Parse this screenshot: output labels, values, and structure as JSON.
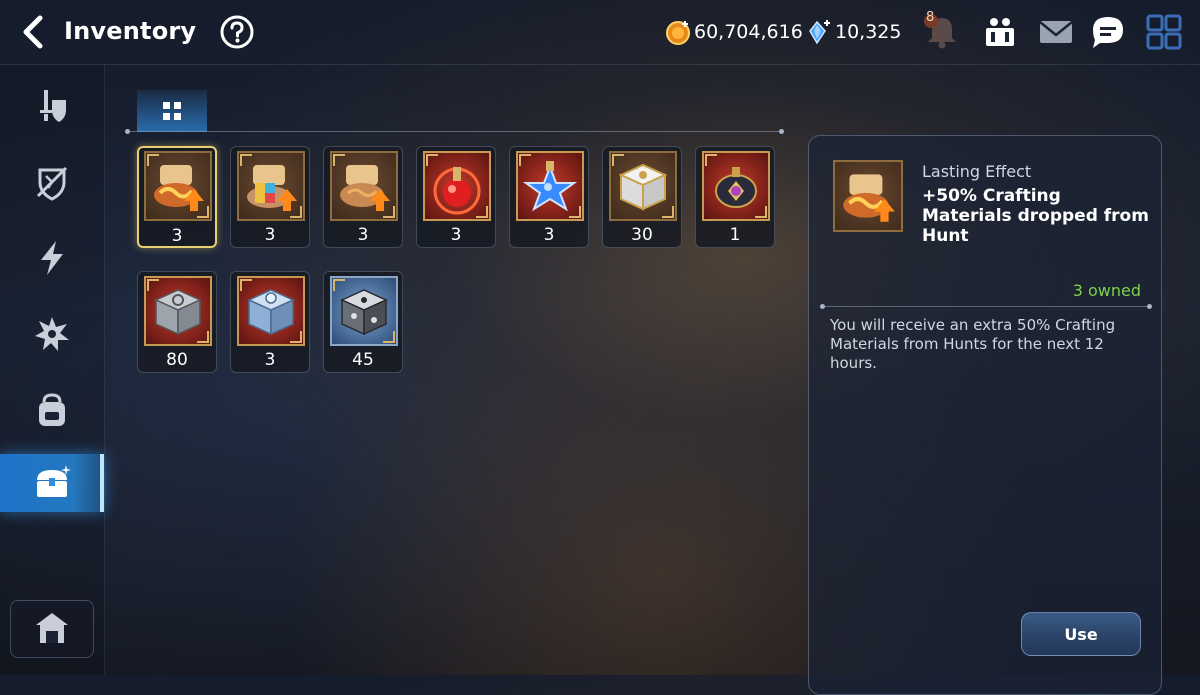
{
  "header": {
    "title": "Inventory",
    "back_icon": "chevron-left-icon",
    "help_icon": "question-circle-icon",
    "gold": "60,704,616",
    "crystals": "10,325",
    "notification_count": "8"
  },
  "sidebar": {
    "items": [
      {
        "icon": "equipment-icon"
      },
      {
        "icon": "broken-shield-icon"
      },
      {
        "icon": "lightning-icon"
      },
      {
        "icon": "burst-icon"
      },
      {
        "icon": "backpack-icon"
      },
      {
        "icon": "treasure-chest-icon",
        "active": true
      }
    ],
    "bottom_icon": "storage-house-icon"
  },
  "tab": {
    "icon": "grid-icon"
  },
  "items": [
    {
      "name": "scroll-orange",
      "qty": "3",
      "selected": true
    },
    {
      "name": "scroll-rainbow",
      "qty": "3"
    },
    {
      "name": "scroll-plain",
      "qty": "3"
    },
    {
      "name": "red-potion",
      "qty": "3"
    },
    {
      "name": "blue-star-potion",
      "qty": "3"
    },
    {
      "name": "white-gold-chest",
      "qty": "30"
    },
    {
      "name": "dark-lantern",
      "qty": "1"
    },
    {
      "name": "silver-chest",
      "qty": "80"
    },
    {
      "name": "blue-silver-chest",
      "qty": "3"
    },
    {
      "name": "dark-cube-chest",
      "qty": "45"
    }
  ],
  "detail": {
    "type": "Lasting Effect",
    "name": "+50% Crafting Materials dropped from Hunt",
    "owned": "3 owned",
    "description": "You will receive an extra 50% Crafting Materials from Hunts for the next 12 hours.",
    "use_label": "Use"
  },
  "colors": {
    "accent": "#2f8fe0",
    "owned_green": "#7fd04a",
    "selected_border": "#e8cf72"
  }
}
